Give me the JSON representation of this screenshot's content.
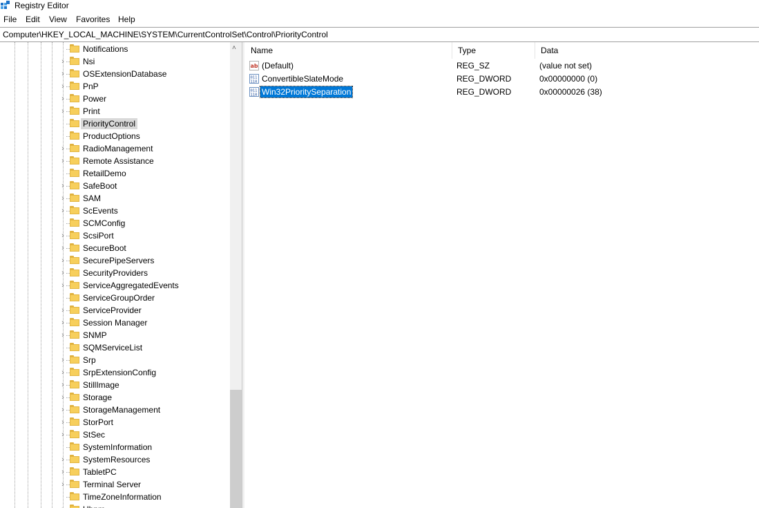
{
  "window": {
    "title": "Registry Editor"
  },
  "menu": [
    "File",
    "Edit",
    "View",
    "Favorites",
    "Help"
  ],
  "address": "Computer\\HKEY_LOCAL_MACHINE\\SYSTEM\\CurrentControlSet\\Control\\PriorityControl",
  "tree": {
    "selected": "PriorityControl",
    "items": [
      {
        "label": "Notifications",
        "expandable": false
      },
      {
        "label": "Nsi",
        "expandable": true
      },
      {
        "label": "OSExtensionDatabase",
        "expandable": true
      },
      {
        "label": "PnP",
        "expandable": true
      },
      {
        "label": "Power",
        "expandable": true
      },
      {
        "label": "Print",
        "expandable": true
      },
      {
        "label": "PriorityControl",
        "expandable": false
      },
      {
        "label": "ProductOptions",
        "expandable": false
      },
      {
        "label": "RadioManagement",
        "expandable": true
      },
      {
        "label": "Remote Assistance",
        "expandable": true
      },
      {
        "label": "RetailDemo",
        "expandable": false
      },
      {
        "label": "SafeBoot",
        "expandable": true
      },
      {
        "label": "SAM",
        "expandable": true
      },
      {
        "label": "ScEvents",
        "expandable": true
      },
      {
        "label": "SCMConfig",
        "expandable": false
      },
      {
        "label": "ScsiPort",
        "expandable": true
      },
      {
        "label": "SecureBoot",
        "expandable": true
      },
      {
        "label": "SecurePipeServers",
        "expandable": true
      },
      {
        "label": "SecurityProviders",
        "expandable": true
      },
      {
        "label": "ServiceAggregatedEvents",
        "expandable": true
      },
      {
        "label": "ServiceGroupOrder",
        "expandable": false
      },
      {
        "label": "ServiceProvider",
        "expandable": true
      },
      {
        "label": "Session Manager",
        "expandable": true
      },
      {
        "label": "SNMP",
        "expandable": true
      },
      {
        "label": "SQMServiceList",
        "expandable": false
      },
      {
        "label": "Srp",
        "expandable": true
      },
      {
        "label": "SrpExtensionConfig",
        "expandable": true
      },
      {
        "label": "StillImage",
        "expandable": true
      },
      {
        "label": "Storage",
        "expandable": true
      },
      {
        "label": "StorageManagement",
        "expandable": true
      },
      {
        "label": "StorPort",
        "expandable": true
      },
      {
        "label": "StSec",
        "expandable": true
      },
      {
        "label": "SystemInformation",
        "expandable": false
      },
      {
        "label": "SystemResources",
        "expandable": true
      },
      {
        "label": "TabletPC",
        "expandable": true
      },
      {
        "label": "Terminal Server",
        "expandable": true
      },
      {
        "label": "TimeZoneInformation",
        "expandable": false
      },
      {
        "label": "Ubpm",
        "expandable": true
      }
    ]
  },
  "values": {
    "columns": {
      "name": "Name",
      "type": "Type",
      "data": "Data"
    },
    "rows": [
      {
        "icon": "string-value-icon",
        "name": "(Default)",
        "type": "REG_SZ",
        "data": "(value not set)",
        "selected": false
      },
      {
        "icon": "dword-value-icon",
        "name": "ConvertibleSlateMode",
        "type": "REG_DWORD",
        "data": "0x00000000 (0)",
        "selected": false
      },
      {
        "icon": "dword-value-icon",
        "name": "Win32PrioritySeparation",
        "type": "REG_DWORD",
        "data": "0x00000026 (38)",
        "selected": true
      }
    ]
  },
  "colors": {
    "selection": "#0078d7",
    "folder": "#f7cf5c",
    "tree_selected": "#d9d9d9"
  }
}
